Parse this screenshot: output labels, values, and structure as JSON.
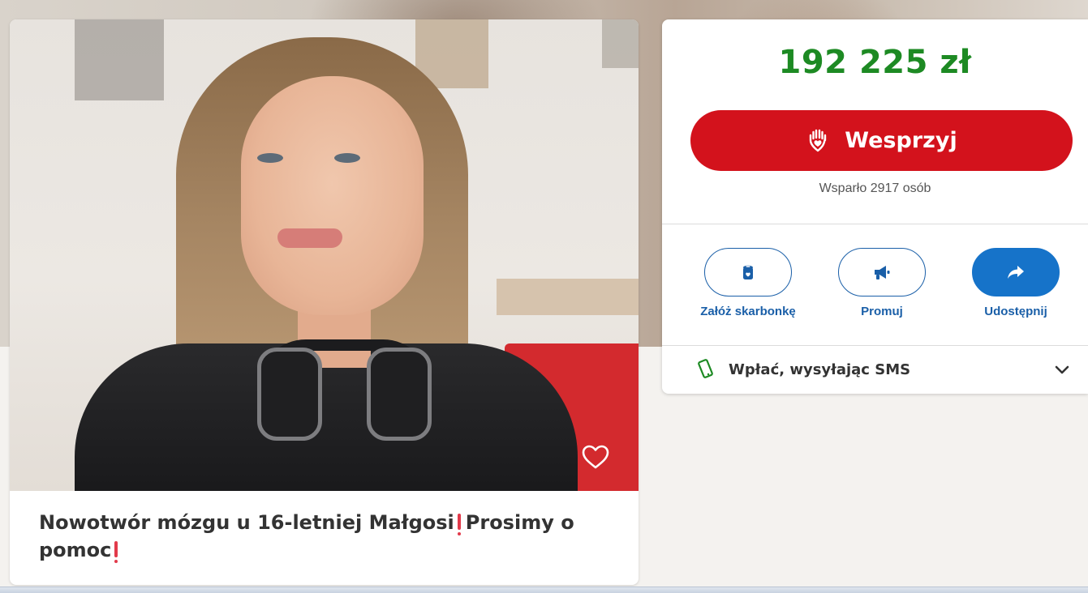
{
  "campaign": {
    "title_part1": "Nowotwór mózgu u 16-letniej Małgosi",
    "title_part2": "Prosimy o pomoc"
  },
  "donation": {
    "amount": "192 225 zł",
    "support_button_label": "Wesprzyj",
    "supporters_text": "Wsparło 2917 osób"
  },
  "actions": [
    {
      "label": "Załóż skarbonkę",
      "icon": "piggy-bank-jar-icon"
    },
    {
      "label": "Promuj",
      "icon": "megaphone-icon"
    },
    {
      "label": "Udostępnij",
      "icon": "share-arrow-icon"
    }
  ],
  "sms": {
    "label": "Wpłać, wysyłając SMS",
    "icon": "mobile-phone-icon"
  },
  "colors": {
    "amount_green": "#1d8a23",
    "support_red": "#d3121c",
    "action_blue": "#1a5fa8",
    "share_blue": "#1673c9",
    "exclamation_red": "#e23a4b"
  }
}
